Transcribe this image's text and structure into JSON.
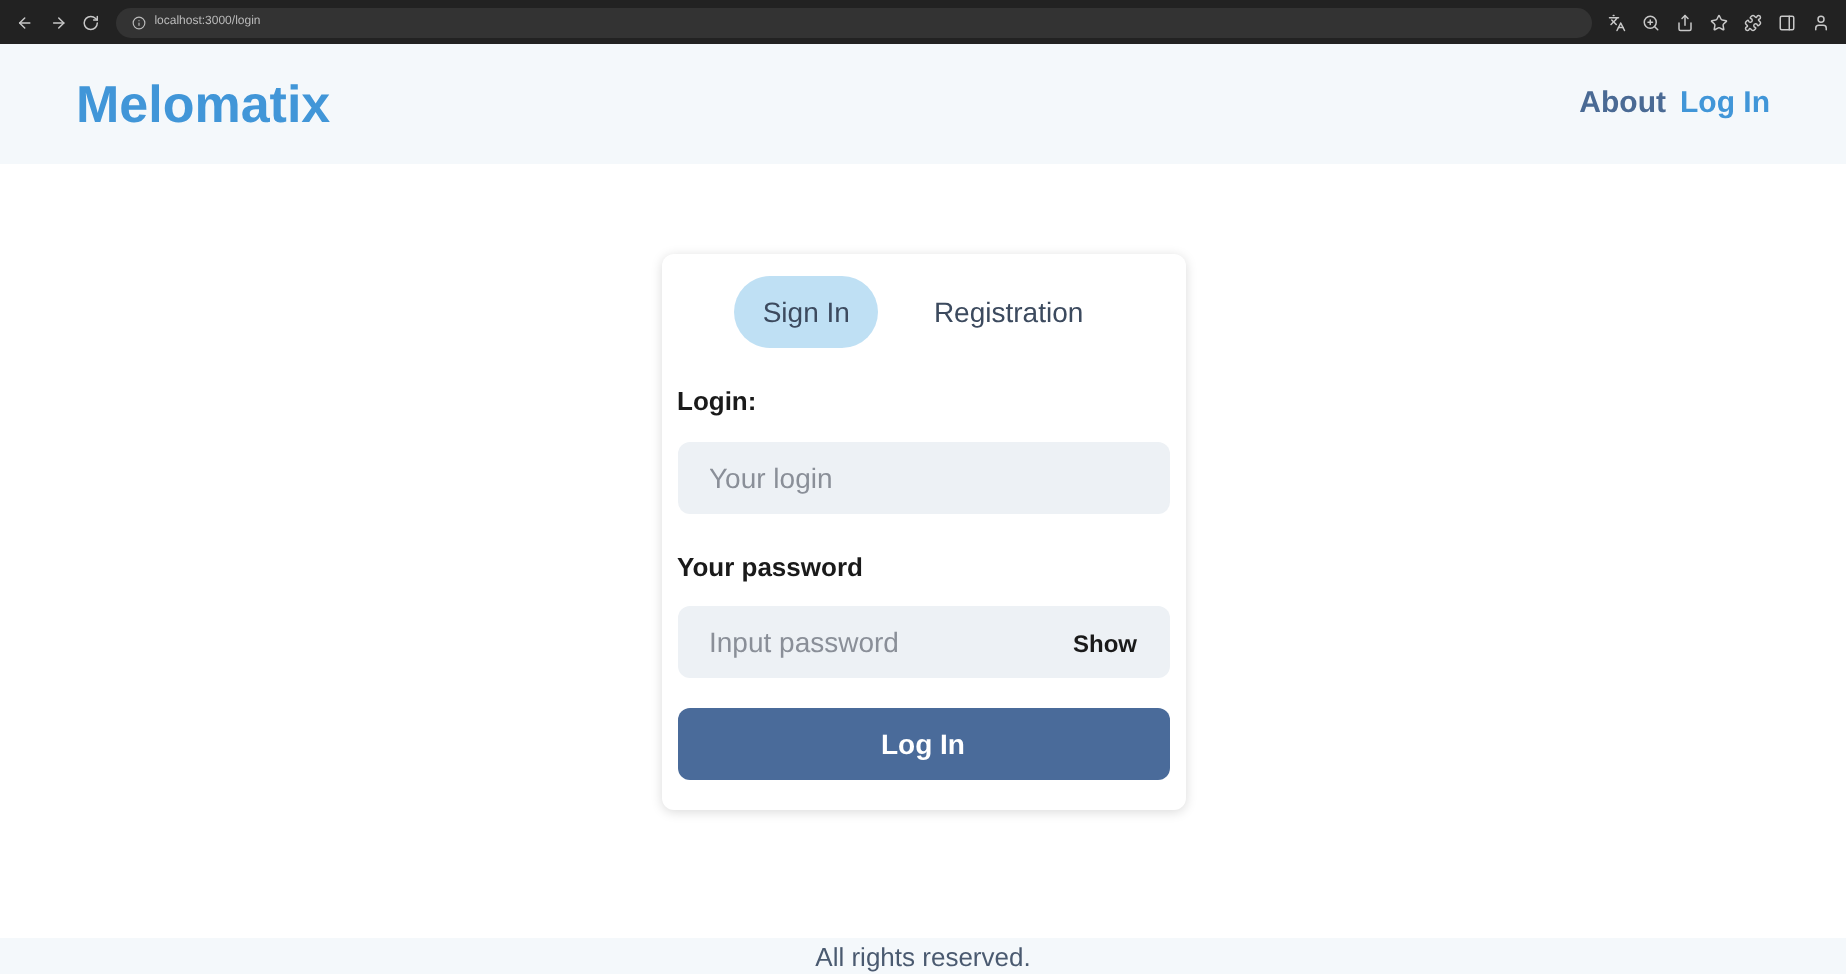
{
  "browser": {
    "url": "localhost:3000/login"
  },
  "header": {
    "logo": "Melomatix",
    "links": [
      {
        "label": "About",
        "selected": false
      },
      {
        "label": "Log In",
        "selected": true
      }
    ]
  },
  "tabs": [
    {
      "label": "Sign In",
      "selected": true
    },
    {
      "label": "Registration",
      "selected": false
    }
  ],
  "fields": [
    {
      "label": "Login:",
      "placeholder": "Your login"
    },
    {
      "label": "Your password",
      "placeholder": "Input password",
      "toggle": "Show"
    }
  ],
  "submit": "Log In",
  "footer": "All rights reserved."
}
